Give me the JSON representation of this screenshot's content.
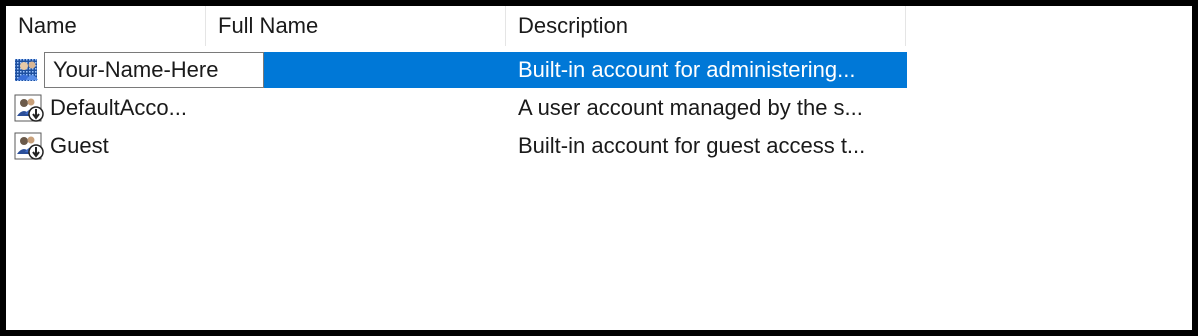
{
  "columns": {
    "name": "Name",
    "full_name": "Full Name",
    "description": "Description"
  },
  "rows": [
    {
      "name": "Your-Name-Here",
      "full_name": "",
      "description": "Built-in account for administering...",
      "selected": true,
      "editing": true,
      "icon": "user-account-icon"
    },
    {
      "name": "DefaultAcco...",
      "full_name": "",
      "description": "A user account managed by the s...",
      "selected": false,
      "editing": false,
      "icon": "disabled-user-account-icon"
    },
    {
      "name": "Guest",
      "full_name": "",
      "description": "Built-in account for guest access t...",
      "selected": false,
      "editing": false,
      "icon": "disabled-user-account-icon"
    }
  ],
  "colors": {
    "selection": "#0078d7",
    "background": "#ffffff",
    "frame": "#000000"
  }
}
